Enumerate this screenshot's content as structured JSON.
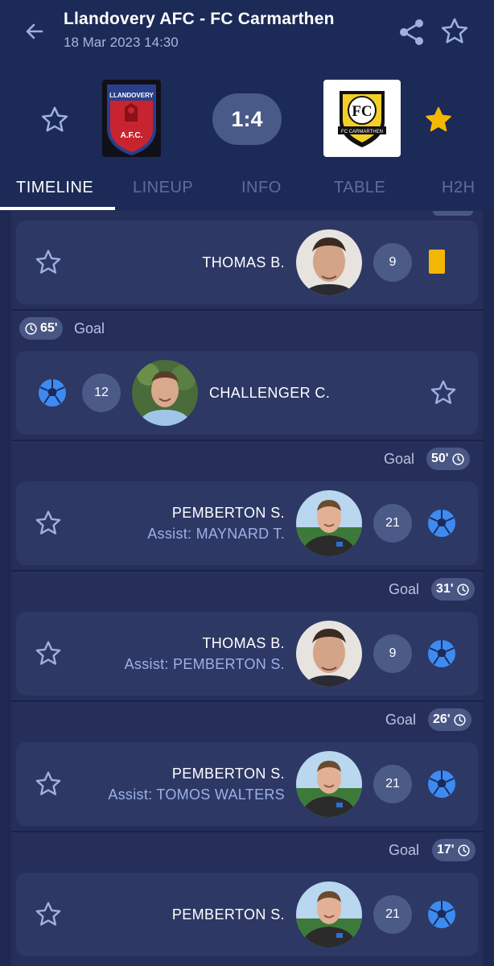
{
  "header": {
    "title": "Llandovery AFC - FC Carmarthen",
    "datetime": "18 Mar 2023 14:30",
    "score": "1:4"
  },
  "home_team": {
    "crest_text_top": "LLANDOVERY",
    "crest_text_bottom": "A.F.C.",
    "favorited": false
  },
  "away_team": {
    "crest_text": "FC",
    "crest_caption": "FC CARMARTHEN",
    "favorited": true
  },
  "tabs": [
    {
      "label": "TIMELINE",
      "active": true
    },
    {
      "label": "LINEUP",
      "active": false
    },
    {
      "label": "INFO",
      "active": false
    },
    {
      "label": "TABLE",
      "active": false
    },
    {
      "label": "H2H",
      "active": false
    }
  ],
  "events": [
    {
      "side": "away",
      "type": "yellow-card",
      "player": "THOMAS B.",
      "number": "9",
      "assist": ""
    },
    {
      "side": "home",
      "type": "goal",
      "label": "Goal",
      "minute": "65'",
      "player": "CHALLENGER C.",
      "number": "12",
      "assist": ""
    },
    {
      "side": "away",
      "type": "goal",
      "label": "Goal",
      "minute": "50'",
      "player": "PEMBERTON S.",
      "number": "21",
      "assist": "Assist: MAYNARD T."
    },
    {
      "side": "away",
      "type": "goal",
      "label": "Goal",
      "minute": "31'",
      "player": "THOMAS B.",
      "number": "9",
      "assist": "Assist: PEMBERTON S."
    },
    {
      "side": "away",
      "type": "goal",
      "label": "Goal",
      "minute": "26'",
      "player": "PEMBERTON S.",
      "number": "21",
      "assist": "Assist: TOMOS WALTERS"
    },
    {
      "side": "away",
      "type": "goal",
      "label": "Goal",
      "minute": "17'",
      "player": "PEMBERTON S.",
      "number": "21",
      "assist": ""
    }
  ],
  "colors": {
    "background": "#1f2a52",
    "card": "#2d3865",
    "accent_blue": "#3d8bf0",
    "yellow_card": "#f2b705",
    "star_active": "#f5b800",
    "assist_text": "#9cb0e6"
  }
}
